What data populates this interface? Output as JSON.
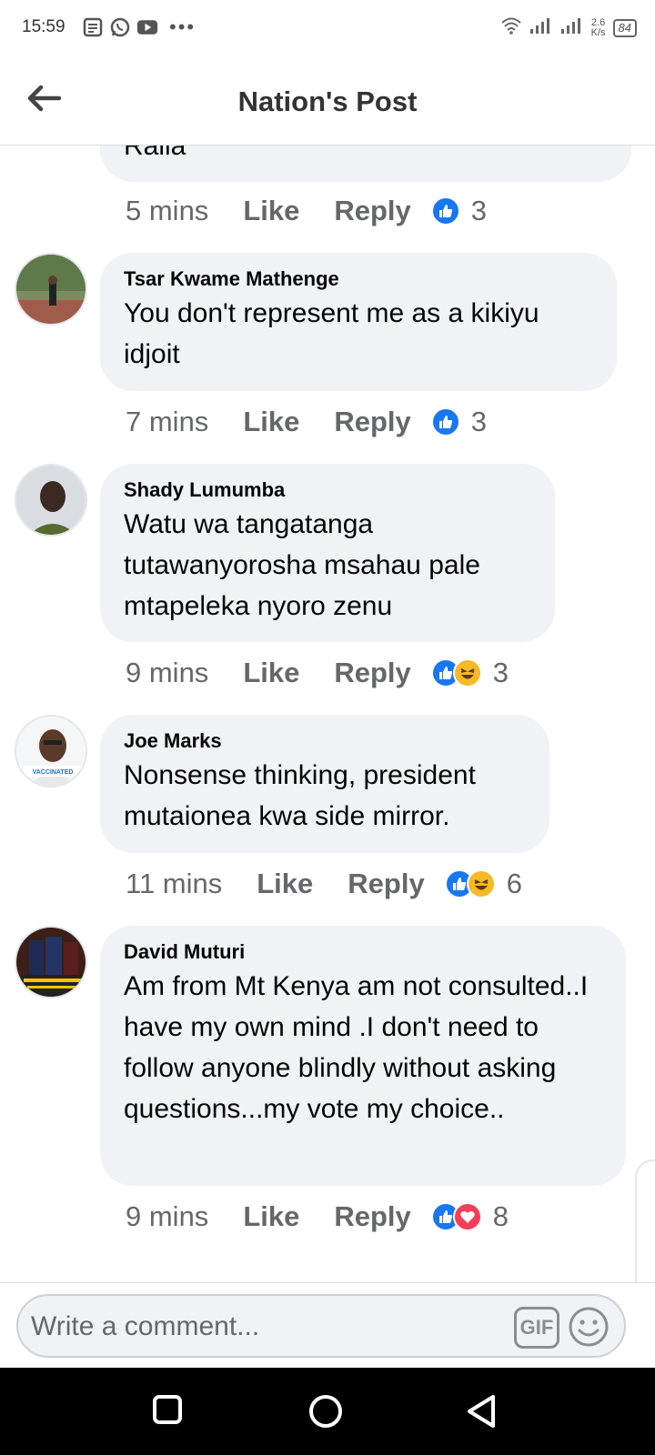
{
  "status_bar": {
    "time": "15:59",
    "speed_value": "2.6",
    "speed_unit": "K/s",
    "battery": "84"
  },
  "header": {
    "title": "Nation's Post"
  },
  "comments": [
    {
      "author": "",
      "text": "Raila",
      "time": "5 mins",
      "like_label": "Like",
      "reply_label": "Reply",
      "reactions": [
        "like"
      ],
      "reaction_count": "3"
    },
    {
      "author": "Tsar Kwame Mathenge",
      "text": "You don't represent me as a kikiyu idjoit",
      "time": "7 mins",
      "like_label": "Like",
      "reply_label": "Reply",
      "reactions": [
        "like"
      ],
      "reaction_count": "3"
    },
    {
      "author": "Shady Lumumba",
      "text": "Watu wa tangatanga tutawanyorosha msahau pale mtapeleka nyoro zenu",
      "time": "9 mins",
      "like_label": "Like",
      "reply_label": "Reply",
      "reactions": [
        "like",
        "haha"
      ],
      "reaction_count": "3"
    },
    {
      "author": "Joe Marks",
      "text": "Nonsense thinking, president mutaionea kwa side mirror.",
      "time": "11 mins",
      "like_label": "Like",
      "reply_label": "Reply",
      "reactions": [
        "like",
        "haha"
      ],
      "reaction_count": "6",
      "avatar_badge": "VACCINATED"
    },
    {
      "author": "David Muturi",
      "text": "Am from Mt Kenya am not consulted..I have my own mind .I don't need to follow anyone blindly without asking questions...my vote my choice..",
      "time": "9 mins",
      "like_label": "Like",
      "reply_label": "Reply",
      "reactions": [
        "like",
        "love"
      ],
      "reaction_count": "8"
    }
  ],
  "composer": {
    "placeholder": "Write a comment...",
    "gif_label": "GIF"
  },
  "colors": {
    "facebook_blue": "#1877f2",
    "bubble_bg": "#f0f2f5",
    "secondary_text": "#65676b",
    "haha_yellow": "#f7b928",
    "love_red": "#f33e58"
  },
  "icons": {
    "status_left": [
      "notes-icon",
      "whatsapp-icon",
      "youtube-icon",
      "more-dots-icon"
    ],
    "status_right": [
      "wifi-icon",
      "signal-icon",
      "signal-icon",
      "battery-icon"
    ],
    "header": [
      "back-arrow-icon"
    ],
    "composer": [
      "gif-icon",
      "emoji-icon"
    ],
    "navbar": [
      "square-icon",
      "circle-icon",
      "triangle-back-icon"
    ]
  }
}
